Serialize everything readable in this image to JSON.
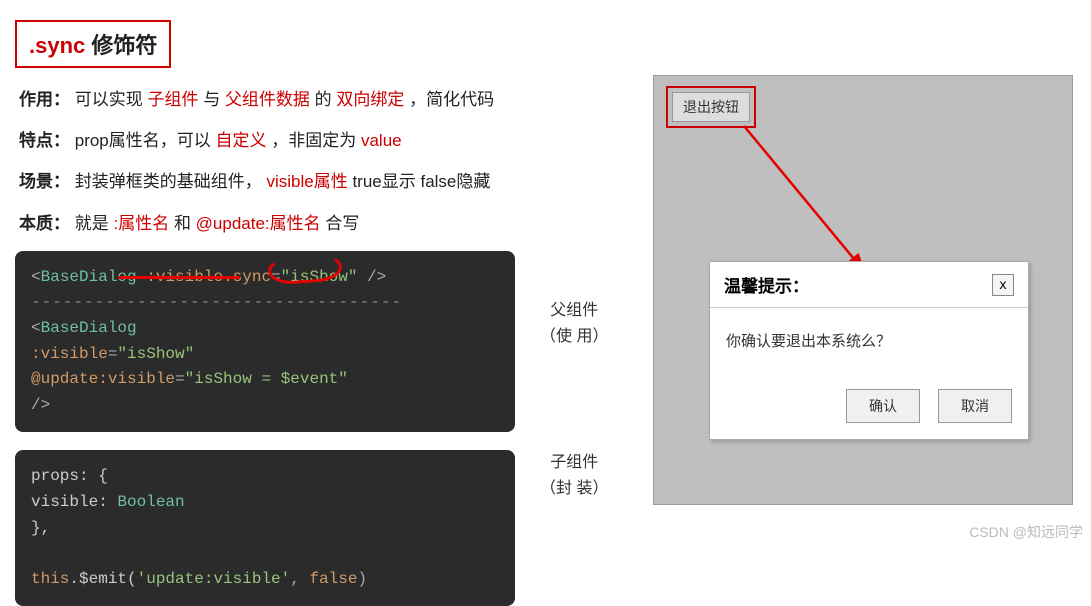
{
  "title": {
    "prefix": ".sync",
    "suffix": " 修饰符"
  },
  "desc": {
    "row1": {
      "label": "作用：",
      "t1": "可以实现 ",
      "hl1": "子组件",
      "t2": " 与 ",
      "hl2": "父组件数据",
      "t3": " 的 ",
      "hl3": "双向绑定",
      "t4": "，简化代码"
    },
    "row2": {
      "label": "特点：",
      "t1": "prop属性名，可以",
      "hl1": "自定义",
      "t2": "，非固定为 ",
      "hl2": "value"
    },
    "row3": {
      "label": "场景：",
      "t1": "封装弹框类的基础组件， ",
      "hl1": "visible属性",
      "t2": " true显示 false隐藏"
    },
    "row4": {
      "label": "本质：",
      "t1": "就是 ",
      "hl1": ":属性名",
      "t2": " 和 ",
      "hl2": "@update:属性名",
      "t3": " 合写"
    }
  },
  "code1": {
    "l1_open": "<",
    "l1_tag": "BaseDialog",
    "l1_attr": " :visible.sync",
    "l1_eq": "=",
    "l1_str": "\"isShow\"",
    "l1_close": " />",
    "sep": "-----------------------------------",
    "l2_open": "<",
    "l2_tag": "BaseDialog",
    "l3_attr": "  :visible",
    "l3_eq": "=",
    "l3_str": "\"isShow\"",
    "l4_attr": "  @update:visible",
    "l4_eq": "=",
    "l4_str": "\"isShow = $event\"",
    "l5_close": "/>"
  },
  "code2": {
    "l1": "props: {",
    "l2a": "  visible: ",
    "l2b": "Boolean",
    "l3": "},",
    "gap": "",
    "l4a": "this",
    "l4b": ".$emit(",
    "l4c": "'update:visible'",
    "l4d": ", ",
    "l4e": "false",
    "l4f": ")"
  },
  "annotations": {
    "parent": {
      "top": "父组件",
      "bottom": "（使 用）"
    },
    "child": {
      "top": "子组件",
      "bottom": "（封 装）"
    }
  },
  "demo": {
    "logout_btn": "退出按钮",
    "dialog": {
      "title": "温馨提示：",
      "close": "x",
      "body": "你确认要退出本系统么？",
      "confirm": "确认",
      "cancel": "取消"
    }
  },
  "watermark": "CSDN @知远同学"
}
